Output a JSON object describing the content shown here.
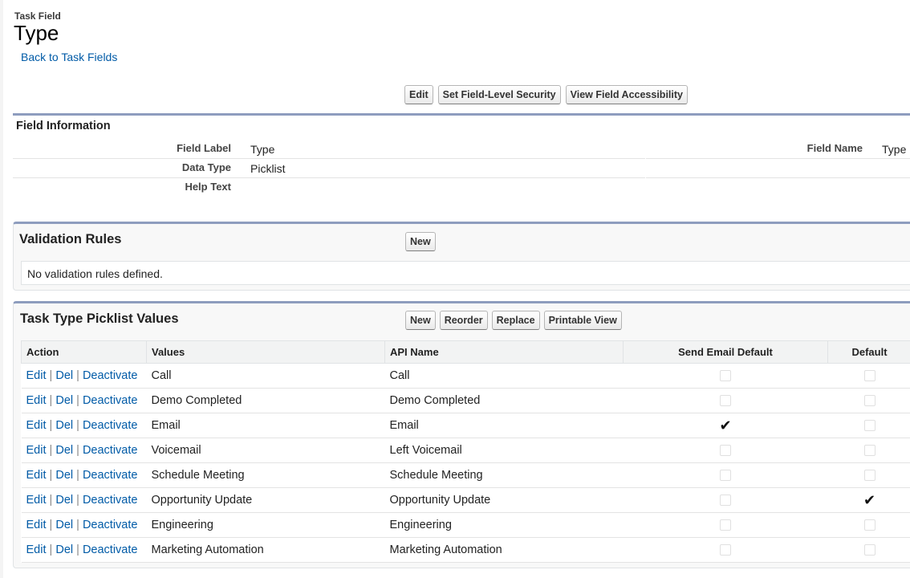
{
  "header": {
    "object_type": "Task Field",
    "title": "Type",
    "back_link": "Back to Task Fields"
  },
  "top_buttons": [
    "Edit",
    "Set Field-Level Security",
    "View Field Accessibility"
  ],
  "field_information": {
    "title": "Field Information",
    "field_label": {
      "label": "Field Label",
      "value": "Type"
    },
    "data_type": {
      "label": "Data Type",
      "value": "Picklist"
    },
    "help_text": {
      "label": "Help Text",
      "value": ""
    },
    "field_name": {
      "label": "Field Name",
      "value": "Type"
    }
  },
  "validation_rules": {
    "title": "Validation Rules",
    "new_label": "New",
    "empty_message": "No validation rules defined."
  },
  "picklist": {
    "title": "Task Type Picklist Values",
    "buttons": [
      "New",
      "Reorder",
      "Replace",
      "Printable View"
    ],
    "columns": [
      "Action",
      "Values",
      "API Name",
      "Send Email Default",
      "Default"
    ],
    "actions": {
      "edit": "Edit",
      "del": "Del",
      "deactivate": "Deactivate",
      "separator": "|"
    },
    "rows": [
      {
        "value": "Call",
        "api_name": "Call",
        "send_email_default": false,
        "default": false
      },
      {
        "value": "Demo Completed",
        "api_name": "Demo Completed",
        "send_email_default": false,
        "default": false
      },
      {
        "value": "Email",
        "api_name": "Email",
        "send_email_default": true,
        "default": false
      },
      {
        "value": "Voicemail",
        "api_name": "Left Voicemail",
        "send_email_default": false,
        "default": false
      },
      {
        "value": "Schedule Meeting",
        "api_name": "Schedule Meeting",
        "send_email_default": false,
        "default": false
      },
      {
        "value": "Opportunity Update",
        "api_name": "Opportunity Update",
        "send_email_default": false,
        "default": true
      },
      {
        "value": "Engineering",
        "api_name": "Engineering",
        "send_email_default": false,
        "default": false
      },
      {
        "value": "Marketing Automation",
        "api_name": "Marketing Automation",
        "send_email_default": false,
        "default": false
      }
    ]
  },
  "colors": {
    "link": "#015ba7",
    "section_bar": "#8e9dbe"
  },
  "icons": {
    "checked": "checkmark-icon",
    "unchecked": "empty-checkbox-icon"
  }
}
